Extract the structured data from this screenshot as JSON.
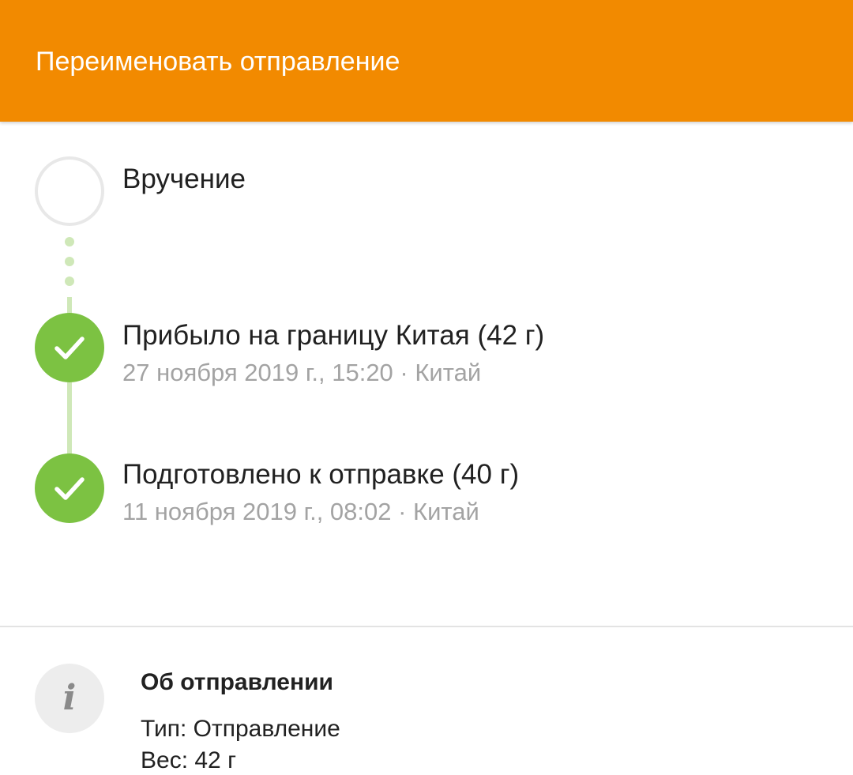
{
  "header": {
    "title": "Переименовать отправление",
    "background": "#f28a00"
  },
  "timeline": {
    "events": [
      {
        "title": "Вручение",
        "status": "pending"
      },
      {
        "title": "Прибыло на границу Китая (42 г)",
        "subtitle": "27 ноября 2019 г., 15:20 · Китай",
        "status": "done",
        "icon": "check-icon"
      },
      {
        "title": "Подготовлено к отправке (40 г)",
        "subtitle": "11 ноября 2019 г., 08:02 · Китай",
        "status": "done",
        "icon": "check-icon"
      }
    ],
    "done_color": "#7cc242",
    "connector_color": "#cfe8b8"
  },
  "info": {
    "icon": "info-icon",
    "icon_glyph": "i",
    "heading": "Об отправлении",
    "type_line": "Тип: Отправление",
    "weight_line": "Вес: 42 г"
  }
}
